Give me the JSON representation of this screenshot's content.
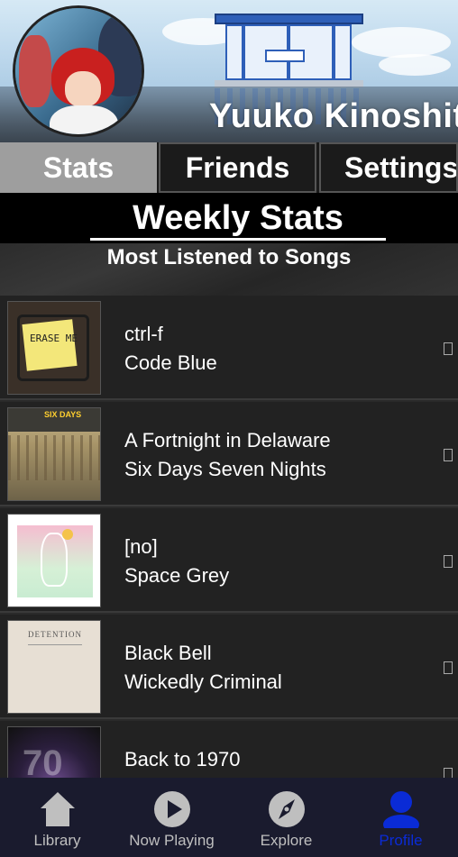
{
  "profile": {
    "username": "Yuuko Kinoshita"
  },
  "tabs": [
    {
      "label": "Stats",
      "active": true
    },
    {
      "label": "Friends",
      "active": false
    },
    {
      "label": "Settings",
      "active": false
    }
  ],
  "stats": {
    "title": "Weekly Stats",
    "subtitle": "Most Listened to Songs"
  },
  "songs": [
    {
      "title": "ctrl-f",
      "artist": "Code Blue",
      "art": "erase-me-album-art"
    },
    {
      "title": "A Fortnight in Delaware",
      "artist": "Six Days Seven Nights",
      "art": "six-days-seven-nights-album-art"
    },
    {
      "title": "[no]",
      "artist": "Space Grey",
      "art": "space-grey-album-art"
    },
    {
      "title": "Black Bell",
      "artist": "Wickedly Criminal",
      "art": "detention-album-art"
    },
    {
      "title": "Back to 1970",
      "artist": "",
      "art": "70s-album-art"
    }
  ],
  "album_texts": {
    "erase_me": "ERASE ME",
    "six_days": "SIX DAYS",
    "detention": "DETENTION",
    "seventy": "70"
  },
  "nav": [
    {
      "label": "Library",
      "icon": "home-icon",
      "active": false
    },
    {
      "label": "Now Playing",
      "icon": "play-icon",
      "active": false
    },
    {
      "label": "Explore",
      "icon": "compass-icon",
      "active": false
    },
    {
      "label": "Profile",
      "icon": "person-icon",
      "active": true
    }
  ],
  "colors": {
    "active_tab": "#9e9e9e",
    "nav_active": "#0a2bd6",
    "nav_background": "#1a1b2e"
  }
}
